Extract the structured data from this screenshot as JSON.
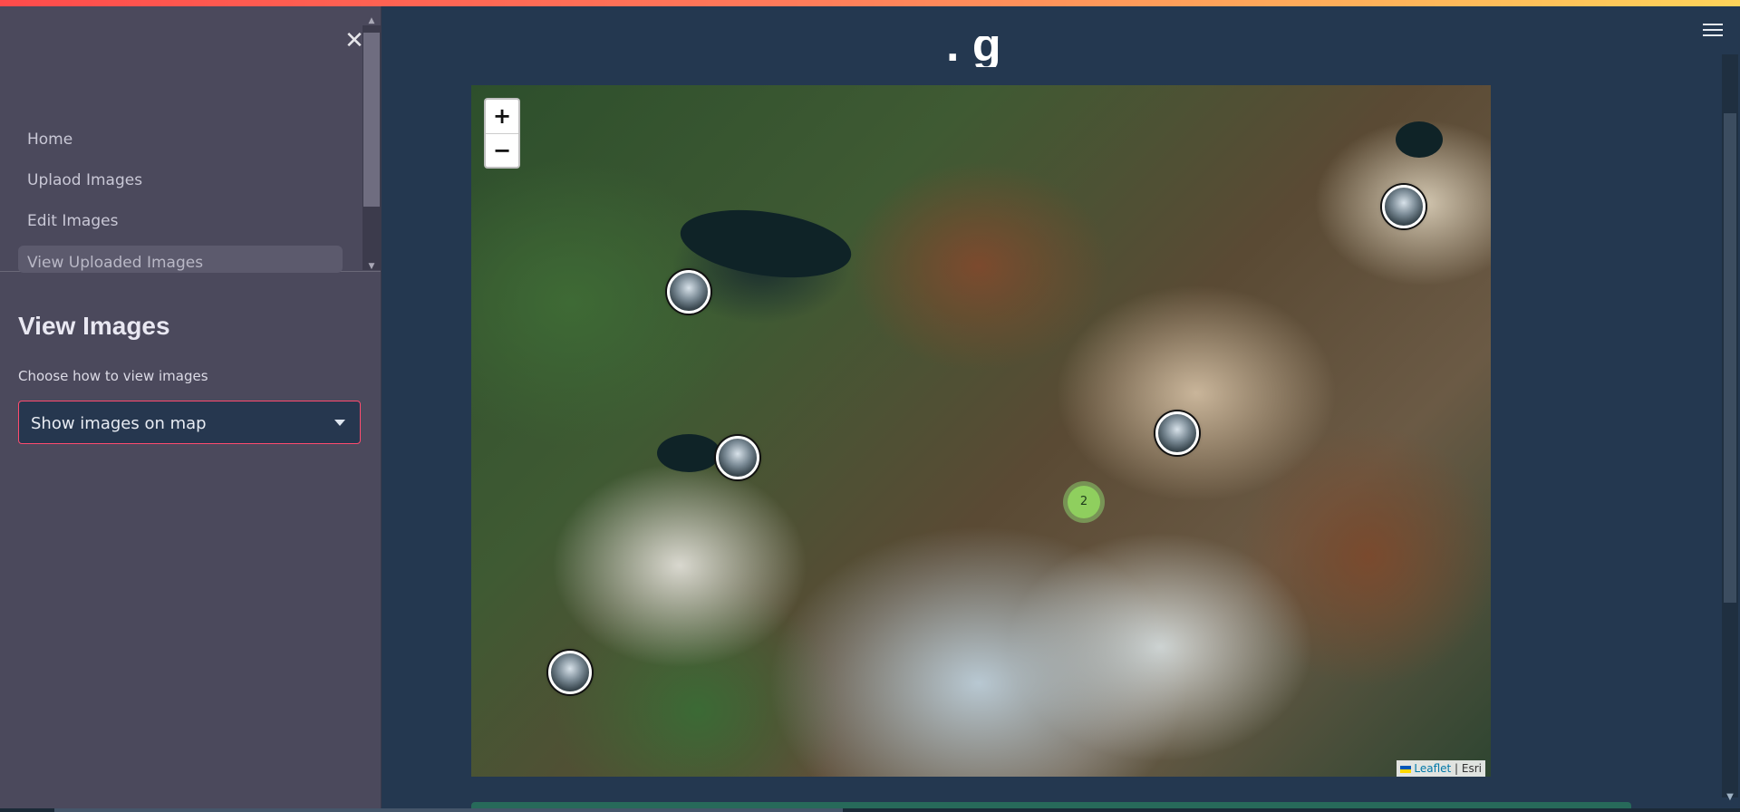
{
  "sidebar": {
    "close_glyph": "✕",
    "nav_items": [
      {
        "label": "Home"
      },
      {
        "label": "Uplaod Images"
      },
      {
        "label": "Edit Images"
      },
      {
        "label": "View Uploaded Images"
      }
    ],
    "section_header": "View Images",
    "select": {
      "label": "Choose how to view images",
      "value": "Show images on map"
    }
  },
  "main": {
    "menu_icon": "hamburger-menu-icon",
    "title_fragment": "  .            g",
    "map": {
      "zoom_in_label": "+",
      "zoom_out_label": "−",
      "cluster_count": "2",
      "attribution": {
        "leaflet": "Leaflet",
        "separator": " | ",
        "provider": "Esri"
      },
      "marker_count": 5
    }
  },
  "colors": {
    "accent": "#ff4b4b",
    "sidebar_bg": "#4b495c",
    "main_bg": "#243850",
    "select_border": "#ff4b6e",
    "cluster": "#8fcf5e"
  }
}
